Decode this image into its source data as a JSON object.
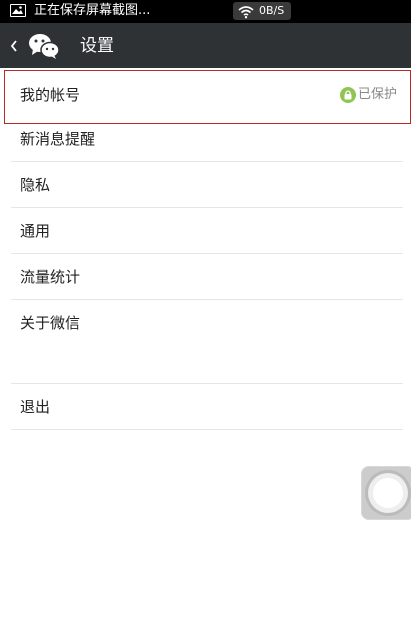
{
  "status_bar": {
    "notification": "正在保存屏幕截图...",
    "net_speed": "0B/S"
  },
  "title_bar": {
    "title": "设置"
  },
  "settings": {
    "items": [
      {
        "label": "我的帐号",
        "badge": "已保护"
      },
      {
        "label": "新消息提醒"
      },
      {
        "label": "隐私"
      },
      {
        "label": "通用"
      },
      {
        "label": "流量统计"
      },
      {
        "label": "关于微信"
      },
      {
        "label": "退出"
      }
    ]
  },
  "colors": {
    "title_bar_bg": "#2f3235",
    "selection_border": "#b82a2a",
    "protect_green": "#8fc555"
  }
}
